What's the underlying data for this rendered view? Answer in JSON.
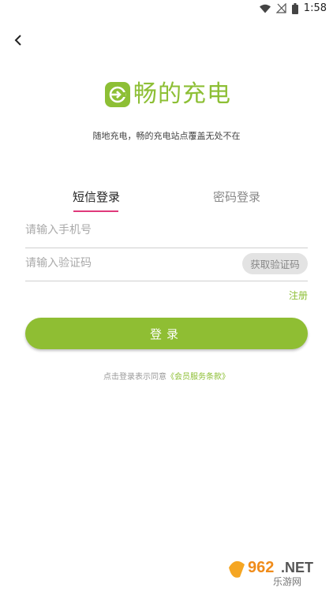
{
  "status_bar": {
    "time": "1:58"
  },
  "brand": {
    "name": "畅的充电",
    "color": "#8dbf35",
    "slogan": "随地充电，畅的充电站点覆盖无处不在"
  },
  "tabs": [
    {
      "label": "短信登录",
      "active": true
    },
    {
      "label": "密码登录",
      "active": false
    }
  ],
  "form": {
    "phone_placeholder": "请输入手机号",
    "code_placeholder": "请输入验证码",
    "get_code_label": "获取验证码",
    "register_label": "注册",
    "login_label": "登录"
  },
  "agreement": {
    "prefix": "点击登录表示同意",
    "link": "《会员服务条款》"
  },
  "watermark": {
    "brand_text": "962.NET",
    "sub_text": "乐游网"
  },
  "colors": {
    "accent": "#8fbe33",
    "tab_indicator": "#e0397a"
  }
}
